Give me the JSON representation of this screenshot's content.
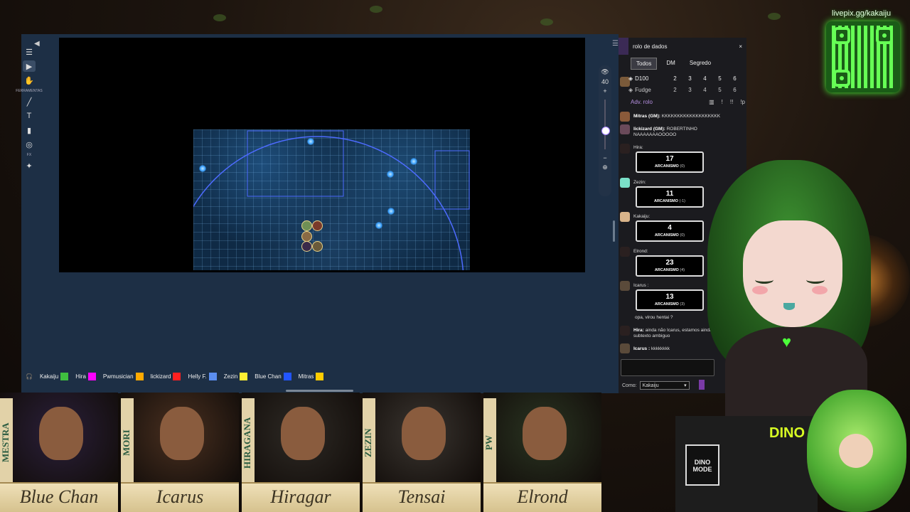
{
  "colors": {
    "vtt_bg": "#1d2f45",
    "chat_bg": "#1b1b1f",
    "accent": "#7a3aa6",
    "qr_green": "#66ff55"
  },
  "toolbar": {
    "icons": [
      "menu-icon",
      "pointer-icon",
      "hand-icon",
      "brush-icon",
      "text-icon",
      "ruler-icon",
      "aoe-icon",
      "wand-icon"
    ],
    "label_ferramentas": "FERRAMENTAS",
    "label_fx": "FX"
  },
  "zoom": {
    "value": "40",
    "plus": "+",
    "minus": "−"
  },
  "players": [
    {
      "name": "Kakaiju",
      "color": "#3fbf3f"
    },
    {
      "name": "Hira",
      "color": "#ff00ff"
    },
    {
      "name": "Pwmusician",
      "color": "#ffaa00"
    },
    {
      "name": "lickizard",
      "color": "#ff2020"
    },
    {
      "name": "Helly F.",
      "color": "#5b8ef0"
    },
    {
      "name": "Zezin",
      "color": "#ffee33"
    },
    {
      "name": "Blue Chan",
      "color": "#2255ff"
    },
    {
      "name": "Mitras",
      "color": "#ffcc00"
    }
  ],
  "chat": {
    "title": "rolo de dados",
    "close": "×",
    "tabs": [
      "Todos",
      "DM",
      "Segredo"
    ],
    "dice": {
      "name": "D100",
      "nums": [
        "2",
        "3",
        "4",
        "5",
        "6"
      ]
    },
    "dice2": {
      "name": "Fudge",
      "nums": [
        "2",
        "3",
        "4",
        "5",
        "6"
      ]
    },
    "adv": {
      "label": "Adv. rolo",
      "ctrls": [
        "▥",
        "!",
        "!!",
        "!p"
      ]
    },
    "messages": [
      {
        "who": "Mitras (GM):",
        "text": "KKKKKKKKKKKKKKKKKKK"
      },
      {
        "who": "lickizard (GM):",
        "text": "ROBERTINHO NAAAAAAAOOOOO"
      },
      {
        "who": "Hira:",
        "roll": "17",
        "label": "ARCANISMO",
        "mod": "(0)"
      },
      {
        "who": "Zezin:",
        "roll": "11",
        "label": "ARCANISMO",
        "mod": "(-1)"
      },
      {
        "who": "Kakaiju:",
        "roll": "4",
        "label": "ARCANISMO",
        "mod": "(0)"
      },
      {
        "who": "Elrond:",
        "roll": "23",
        "label": "ARCANISMO",
        "mod": "(4)"
      },
      {
        "who": "Icarus :",
        "roll": "13",
        "label": "ARCANISMO",
        "mod": "(3)"
      },
      {
        "who": "",
        "text": "opa, virou hentai ?"
      },
      {
        "who": "Hira:",
        "text": "ainda não Icarus, estamos ainda no subtexto ambiguo"
      },
      {
        "who": "Icarus :",
        "text": "kkkkkkkk"
      }
    ],
    "como_label": "Como:",
    "como_value": "Kakaiju"
  },
  "qr": {
    "label": "livepix.gg/kakaiju"
  },
  "shirt": {
    "text": "DINO MODE",
    "tag": "DINO MODE"
  },
  "cards": [
    {
      "vertical": "MESTRA",
      "name": "Blue Chan"
    },
    {
      "vertical": "MORI",
      "name": "Icarus"
    },
    {
      "vertical": "HIRAGANA",
      "name": "Hiragar"
    },
    {
      "vertical": "ZEZIN",
      "name": "Tensai"
    },
    {
      "vertical": "PW",
      "name": "Elrond"
    }
  ]
}
